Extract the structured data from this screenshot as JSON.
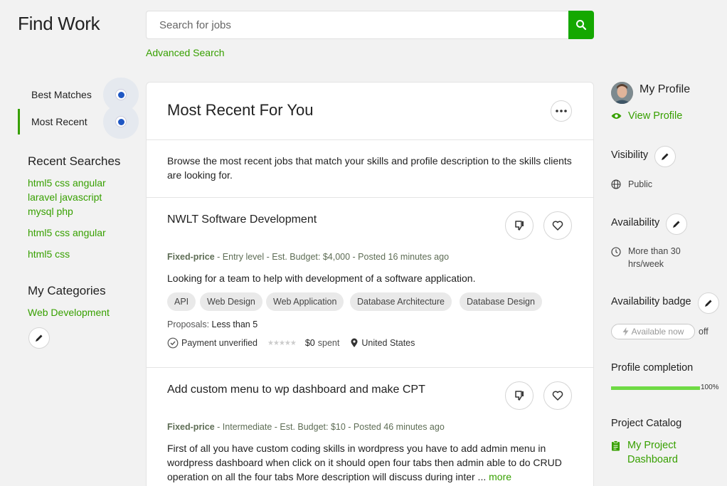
{
  "header": {
    "title": "Find Work",
    "search_placeholder": "Search for jobs",
    "advanced_search": "Advanced Search"
  },
  "nav": {
    "best_matches": "Best Matches",
    "most_recent": "Most Recent"
  },
  "recent_searches": {
    "heading": "Recent Searches",
    "items": [
      "html5 css angular laravel javascript mysql php",
      "html5 css angular",
      "html5 css"
    ]
  },
  "categories": {
    "heading": "My Categories",
    "items": [
      "Web Development"
    ]
  },
  "feed": {
    "title": "Most Recent For You",
    "intro": "Browse the most recent jobs that match your skills and profile description to the skills clients are looking for.",
    "jobs": [
      {
        "title": "NWLT Software Development",
        "type": "Fixed-price",
        "meta": " - Entry level - Est. Budget: $4,000 - Posted 16 minutes ago",
        "description": "Looking for a team to help with development of a software application.",
        "tags": [
          "API",
          "Web Design",
          "Web Application",
          "Database Architecture",
          "Database Design"
        ],
        "proposals_label": "Proposals:",
        "proposals_value": "Less than 5",
        "payment": "Payment unverified",
        "spent_value": "$0",
        "spent_label": "spent",
        "location": "United States"
      },
      {
        "title": "Add custom menu to wp dashboard and make CPT",
        "type": "Fixed-price",
        "meta": " - Intermediate - Est. Budget: $10 - Posted 46 minutes ago",
        "description": "First of all you have custom coding skills in wordpress you have to add admin menu in wordpress dashboard when click on it should open four tabs then admin able to do CRUD operation on all the four tabs More description will discuss during inter ...",
        "more": "more"
      }
    ]
  },
  "profile": {
    "title": "My Profile",
    "view_profile": "View Profile",
    "visibility_label": "Visibility",
    "visibility_value": "Public",
    "availability_label": "Availability",
    "availability_value": "More than 30 hrs/week",
    "badge_label": "Availability badge",
    "badge_pill": "Available now",
    "badge_state": "off",
    "completion_label": "Profile completion",
    "completion_value": "100%",
    "completion_fraction": 1.0,
    "catalog_label": "Project Catalog",
    "catalog_link": "My Project Dashboard"
  },
  "colors": {
    "brand_green": "#14a800",
    "link_green": "#37a000",
    "progress_green": "#6fda44",
    "radio_blue": "#1f57c3"
  }
}
